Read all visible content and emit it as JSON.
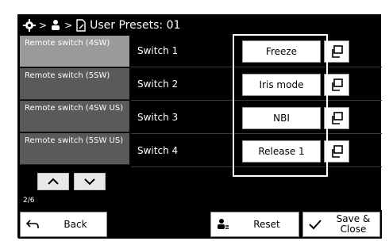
{
  "header": {
    "title": "User Presets: 01",
    "icons": [
      "gear-icon",
      "user-icon",
      "document-icon"
    ],
    "separator": ">"
  },
  "sidebar": {
    "items": [
      {
        "label": "Remote switch (4SW)",
        "active": true
      },
      {
        "label": "Remote switch (5SW)",
        "active": false
      },
      {
        "label": "Remote switch (4SW US)",
        "active": false
      },
      {
        "label": "Remote switch (5SW US)",
        "active": false
      }
    ],
    "page_indicator": "2/6"
  },
  "switches": [
    {
      "label": "Switch 1",
      "value": "Freeze"
    },
    {
      "label": "Switch 2",
      "value": "Iris mode"
    },
    {
      "label": "Switch 3",
      "value": "NBI"
    },
    {
      "label": "Switch 4",
      "value": "Release 1"
    }
  ],
  "footer": {
    "back_label": "Back",
    "reset_label": "Reset",
    "save_label": "Save &\nClose"
  }
}
